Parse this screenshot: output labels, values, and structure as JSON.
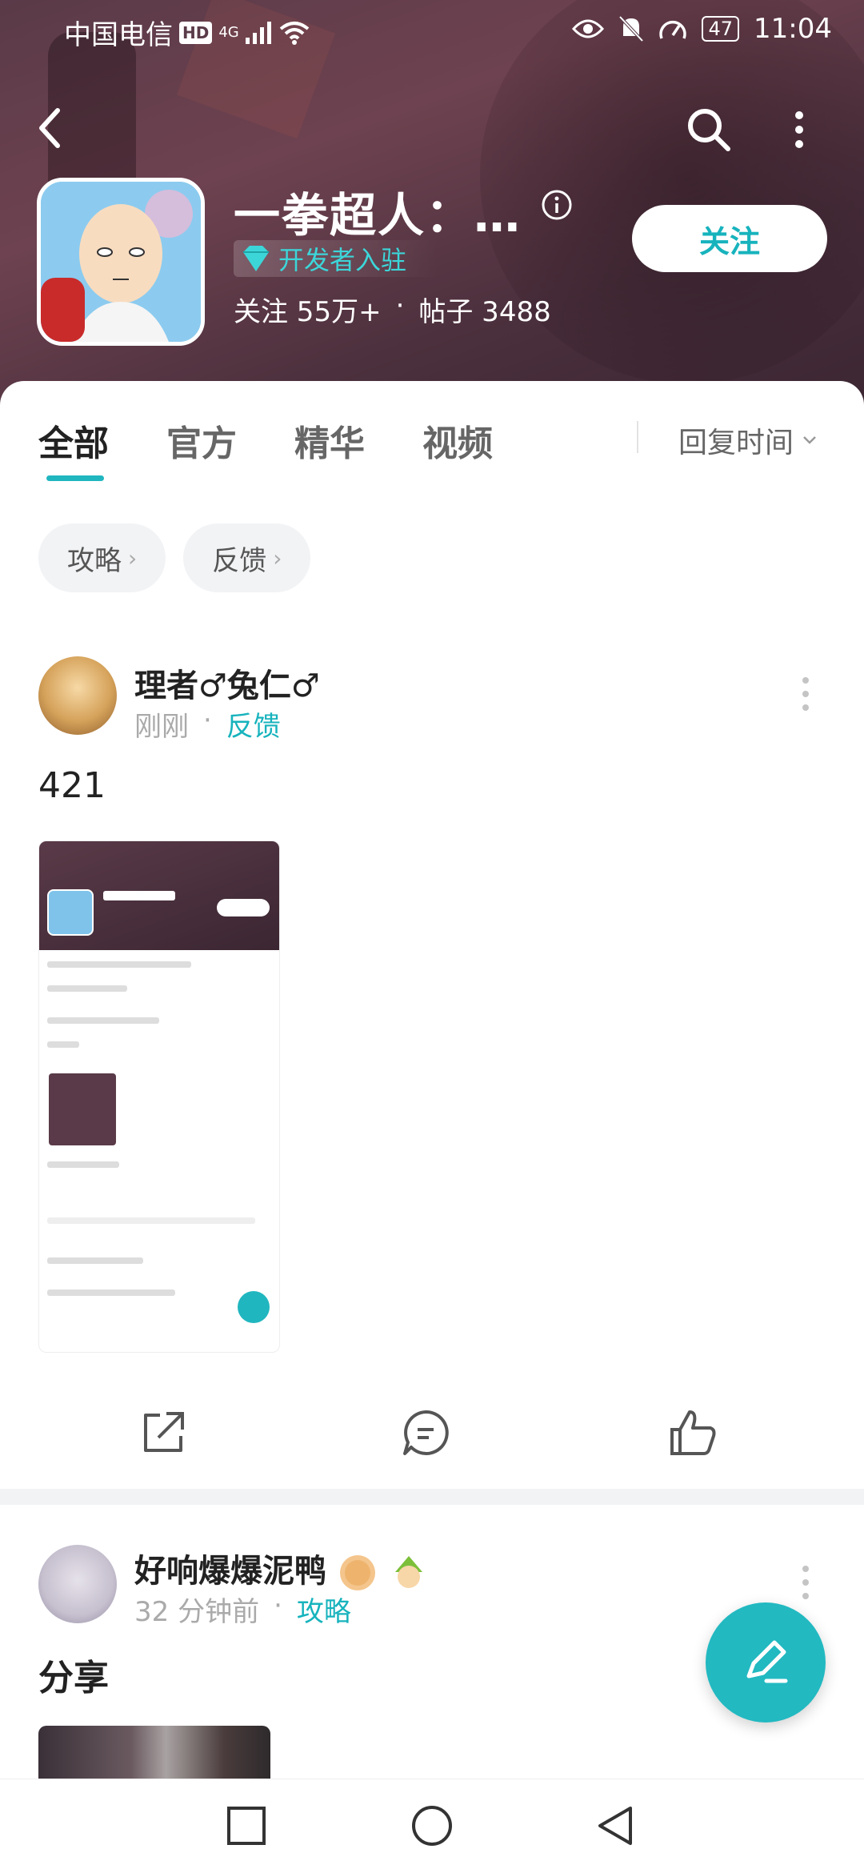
{
  "status_bar": {
    "carrier": "中国电信",
    "hd": "HD",
    "network": "4G",
    "battery": "47",
    "time": "11:04"
  },
  "header": {
    "app_name": "一拳超人：…",
    "developer_badge": "开发者入驻",
    "follow_label": "关注",
    "followers": "关注 55万+",
    "separator": "·",
    "posts": "帖子 3488"
  },
  "tabs": [
    {
      "label": "全部",
      "active": true
    },
    {
      "label": "官方",
      "active": false
    },
    {
      "label": "精华",
      "active": false
    },
    {
      "label": "视频",
      "active": false
    }
  ],
  "sort": {
    "label": "回复时间"
  },
  "chips": [
    {
      "label": "攻略"
    },
    {
      "label": "反馈"
    }
  ],
  "posts": [
    {
      "author": "理者♂兔仁♂",
      "time": "刚刚",
      "separator": "·",
      "category": "反馈",
      "content": "421"
    },
    {
      "author": "好响爆爆泥鸭",
      "time": "32 分钟前",
      "separator": "·",
      "category": "攻略",
      "content": "分享"
    }
  ],
  "colors": {
    "accent": "#20b6bf",
    "header_bg": "#5a3a48"
  },
  "icons": {
    "back": "back-arrow-icon",
    "search": "search-icon",
    "more": "more-vertical-icon",
    "info": "info-icon",
    "diamond": "diamond-icon",
    "share": "share-icon",
    "comment": "comment-icon",
    "like": "thumbs-up-icon",
    "compose": "compose-pen-icon"
  }
}
